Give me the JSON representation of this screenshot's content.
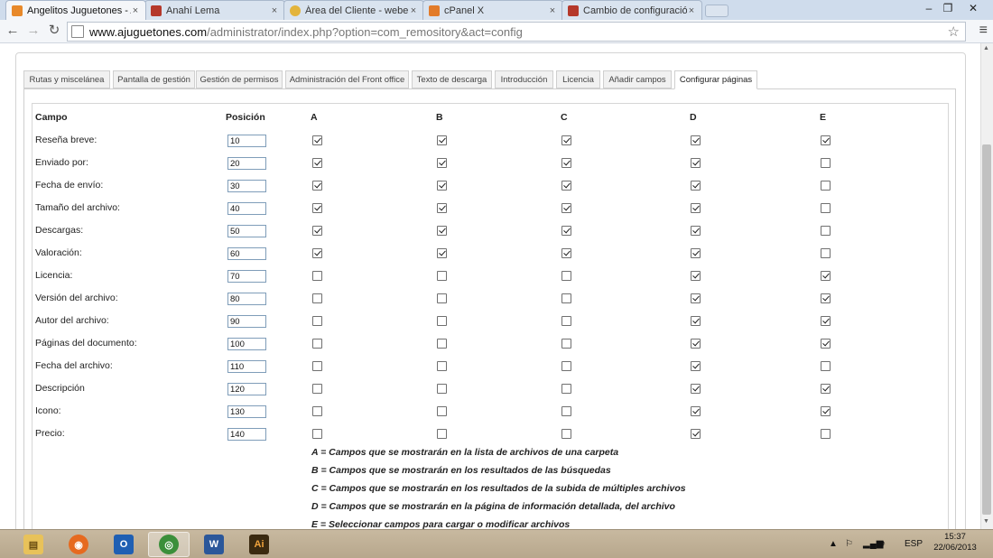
{
  "browser": {
    "tabs": [
      {
        "label": "Angelitos Juguetones - Ac",
        "icon": "joomla-icon",
        "active": true
      },
      {
        "label": "Anahí Lema",
        "icon": "webempresa-icon",
        "active": false
      },
      {
        "label": "Área del Cliente - webemp",
        "icon": "webempresa-client-icon",
        "active": false
      },
      {
        "label": "cPanel X",
        "icon": "cpanel-icon",
        "active": false
      },
      {
        "label": "Cambio de configuración",
        "icon": "webempresa-icon",
        "active": false
      }
    ],
    "tab_close": "×",
    "url_host": "www.ajuguetones.com",
    "url_path": "/administrator/index.php?option=com_remository&act=config",
    "window_controls": {
      "minimize": "–",
      "maximize": "❐",
      "close": "✕"
    }
  },
  "config_tabs": [
    {
      "label": "Rutas y miscelánea",
      "active": false
    },
    {
      "label": "Pantalla de gestión",
      "active": false
    },
    {
      "label": "Gestión de permisos",
      "active": false
    },
    {
      "label": "Administración del Front office",
      "active": false
    },
    {
      "label": "Texto de descarga",
      "active": false
    },
    {
      "label": "Introducción",
      "active": false
    },
    {
      "label": "Licencia",
      "active": false
    },
    {
      "label": "Añadir campos",
      "active": false
    },
    {
      "label": "Configurar páginas",
      "active": true
    }
  ],
  "table": {
    "headers": {
      "campo": "Campo",
      "posicion": "Posición",
      "a": "A",
      "b": "B",
      "c": "C",
      "d": "D",
      "e": "E"
    },
    "rows": [
      {
        "label": "Reseña breve:",
        "position": "10",
        "a": true,
        "b": true,
        "c": true,
        "d": true,
        "e": true
      },
      {
        "label": "Enviado por:",
        "position": "20",
        "a": true,
        "b": true,
        "c": true,
        "d": true,
        "e": false
      },
      {
        "label": "Fecha de envío:",
        "position": "30",
        "a": true,
        "b": true,
        "c": true,
        "d": true,
        "e": false
      },
      {
        "label": "Tamaño del archivo:",
        "position": "40",
        "a": true,
        "b": true,
        "c": true,
        "d": true,
        "e": false
      },
      {
        "label": "Descargas:",
        "position": "50",
        "a": true,
        "b": true,
        "c": true,
        "d": true,
        "e": false
      },
      {
        "label": "Valoración:",
        "position": "60",
        "a": true,
        "b": true,
        "c": true,
        "d": true,
        "e": false
      },
      {
        "label": "Licencia:",
        "position": "70",
        "a": false,
        "b": false,
        "c": false,
        "d": true,
        "e": true
      },
      {
        "label": "Versión del archivo:",
        "position": "80",
        "a": false,
        "b": false,
        "c": false,
        "d": true,
        "e": true
      },
      {
        "label": "Autor del archivo:",
        "position": "90",
        "a": false,
        "b": false,
        "c": false,
        "d": true,
        "e": true
      },
      {
        "label": "Páginas del documento:",
        "position": "100",
        "a": false,
        "b": false,
        "c": false,
        "d": true,
        "e": true
      },
      {
        "label": "Fecha del archivo:",
        "position": "110",
        "a": false,
        "b": false,
        "c": false,
        "d": true,
        "e": false
      },
      {
        "label": "Descripción",
        "position": "120",
        "a": false,
        "b": false,
        "c": false,
        "d": true,
        "e": true
      },
      {
        "label": "Icono:",
        "position": "130",
        "a": false,
        "b": false,
        "c": false,
        "d": true,
        "e": true
      },
      {
        "label": "Precio:",
        "position": "140",
        "a": false,
        "b": false,
        "c": false,
        "d": true,
        "e": false
      }
    ]
  },
  "legend": [
    "A = Campos que se mostrarán en la lista de archivos de una carpeta",
    "B = Campos que se mostrarán en los resultados de las búsquedas",
    "C = Campos que se mostrarán en los resultados de la subida de múltiples archivos",
    "D = Campos que se mostrarán en la página de información detallada, del archivo",
    "E = Seleccionar campos para cargar o modificar archivos"
  ],
  "taskbar": {
    "apps": [
      {
        "name": "file-explorer-icon",
        "glyph": "▤",
        "color": "#e8c25a"
      },
      {
        "name": "firefox-icon",
        "glyph": "◉",
        "color": "#e66a1f"
      },
      {
        "name": "outlook-icon",
        "glyph": "O",
        "color": "#1f5fb3"
      },
      {
        "name": "chrome-icon",
        "glyph": "◎",
        "color": "#3b8f3b"
      },
      {
        "name": "word-icon",
        "glyph": "W",
        "color": "#2b579a"
      },
      {
        "name": "illustrator-icon",
        "glyph": "Ai",
        "color": "#3b2a10"
      }
    ],
    "language": "ESP",
    "time": "15:37",
    "date": "22/06/2013"
  }
}
